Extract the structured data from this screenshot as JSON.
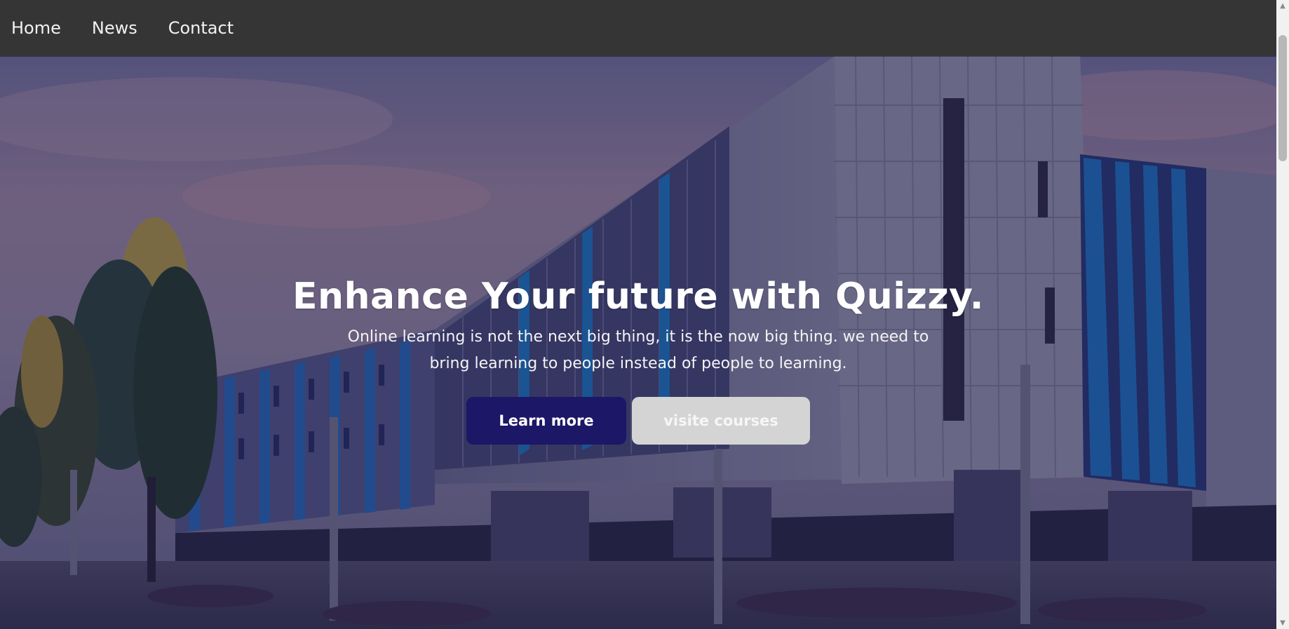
{
  "nav": {
    "items": [
      {
        "label": "Home"
      },
      {
        "label": "News"
      },
      {
        "label": "Contact"
      }
    ]
  },
  "hero": {
    "title": "Enhance Your future with Quizzy.",
    "subtitle": "Online learning is not the next big thing, it is the now big thing. we need to bring learning to people instead of people to learning.",
    "primary_button": "Learn more",
    "secondary_button": "visite courses"
  },
  "colors": {
    "nav_bg": "#353535",
    "primary_button": "#1c1767",
    "secondary_button": "#d4d4d4"
  },
  "icons": {
    "scroll_up": "triangle-up-icon",
    "scroll_down": "triangle-down-icon"
  }
}
